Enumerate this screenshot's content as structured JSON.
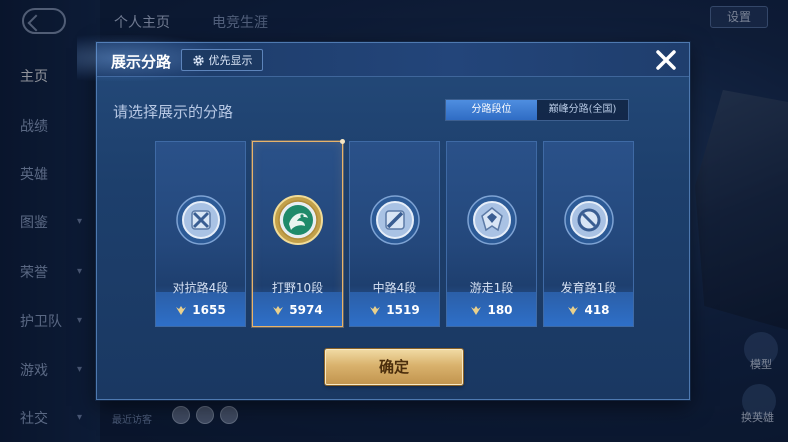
{
  "background": {
    "top_tabs": [
      "个人主页",
      "电竞生涯"
    ],
    "settings_label": "设置",
    "sidebar": [
      {
        "label": "主页",
        "active": true
      },
      {
        "label": "战绩"
      },
      {
        "label": "英雄"
      },
      {
        "label": "图鉴"
      },
      {
        "label": "荣誉"
      },
      {
        "label": "护卫队"
      },
      {
        "label": "游戏"
      },
      {
        "label": "社交"
      }
    ],
    "right_labels": {
      "model": "模型",
      "switch_hero": "换英雄"
    },
    "recent_visitors_label": "最近访客"
  },
  "modal": {
    "title": "展示分路",
    "priority_label": "优先显示",
    "subtitle": "请选择展示的分路",
    "toggle": [
      {
        "label": "分路段位",
        "active": true
      },
      {
        "label": "巅峰分路(全国)",
        "active": false
      }
    ],
    "lanes": [
      {
        "name": "对抗路4段",
        "score": "1655",
        "emblem": "clash-lane-icon",
        "selected": false
      },
      {
        "name": "打野10段",
        "score": "5974",
        "emblem": "jungle-icon",
        "selected": true
      },
      {
        "name": "中路4段",
        "score": "1519",
        "emblem": "mid-lane-icon",
        "selected": false
      },
      {
        "name": "游走1段",
        "score": "180",
        "emblem": "roam-icon",
        "selected": false
      },
      {
        "name": "发育路1段",
        "score": "418",
        "emblem": "farm-lane-icon",
        "selected": false
      }
    ],
    "confirm_label": "确定"
  },
  "colors": {
    "accent_blue": "#2f6cc4",
    "gold": "#d9b26d",
    "selected_border": "#e8b36a",
    "panel": "#1d3f6c"
  }
}
